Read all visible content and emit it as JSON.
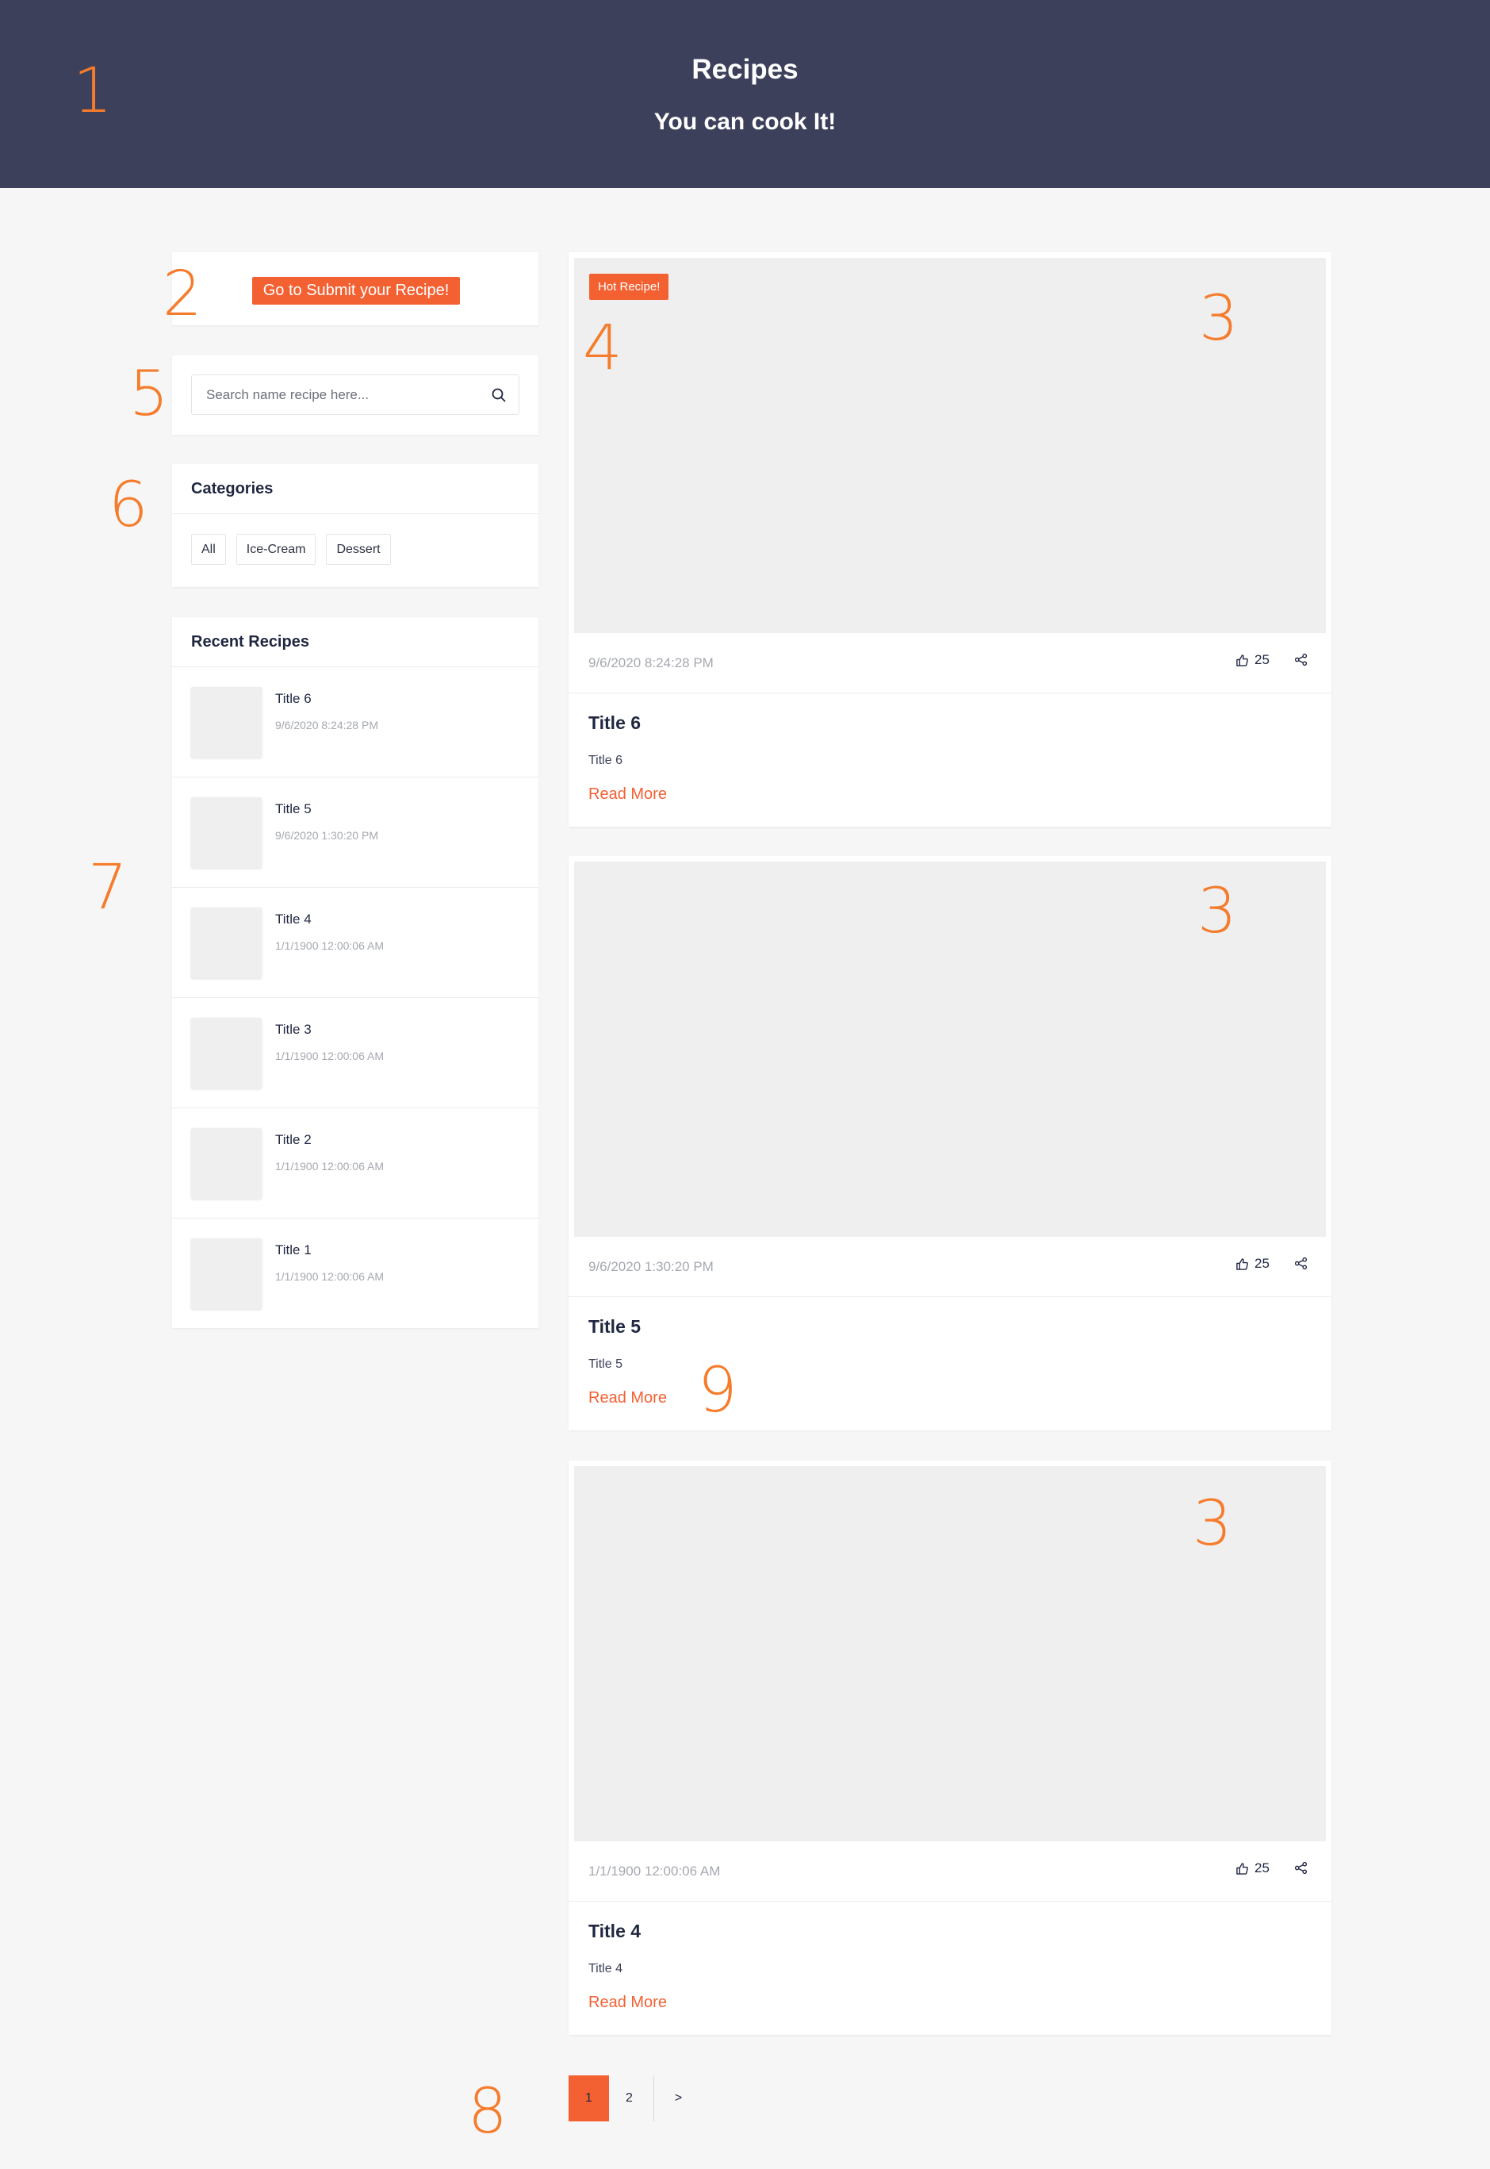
{
  "header": {
    "title": "Recipes",
    "subtitle": "You can cook It!",
    "background_color": "#3d405b"
  },
  "sidebar": {
    "submit_button": "Go to Submit your Recipe!",
    "search": {
      "placeholder": "Search name recipe here...",
      "value": "",
      "icon": "search-icon"
    },
    "categories": {
      "heading": "Categories",
      "items": [
        "All",
        "Ice-Cream",
        "Dessert"
      ]
    },
    "recent": {
      "heading": "Recent Recipes",
      "items": [
        {
          "title": "Title 6",
          "date": "9/6/2020 8:24:28 PM"
        },
        {
          "title": "Title 5",
          "date": "9/6/2020 1:30:20 PM"
        },
        {
          "title": "Title 4",
          "date": "1/1/1900 12:00:06 AM"
        },
        {
          "title": "Title 3",
          "date": "1/1/1900 12:00:06 AM"
        },
        {
          "title": "Title 2",
          "date": "1/1/1900 12:00:06 AM"
        },
        {
          "title": "Title 1",
          "date": "1/1/1900 12:00:06 AM"
        }
      ]
    }
  },
  "posts": [
    {
      "badge": "Hot Recipe!",
      "date": "9/6/2020 8:24:28 PM",
      "likes": "25",
      "title": "Title 6",
      "excerpt": "Title 6",
      "read_more": "Read More"
    },
    {
      "date": "9/6/2020 1:30:20 PM",
      "likes": "25",
      "title": "Title 5",
      "excerpt": "Title 5",
      "read_more": "Read More"
    },
    {
      "date": "1/1/1900 12:00:06 AM",
      "likes": "25",
      "title": "Title 4",
      "excerpt": "Title 4",
      "read_more": "Read More"
    }
  ],
  "pagination": {
    "pages": [
      "1",
      "2"
    ],
    "current": "1",
    "next": ">"
  },
  "annotations": [
    "1",
    "2",
    "3",
    "3",
    "3",
    "4",
    "5",
    "6",
    "7",
    "8",
    "9"
  ],
  "colors": {
    "accent": "#f36133",
    "annotation": "#f57c2d",
    "page_bg": "#f6f6f6"
  }
}
